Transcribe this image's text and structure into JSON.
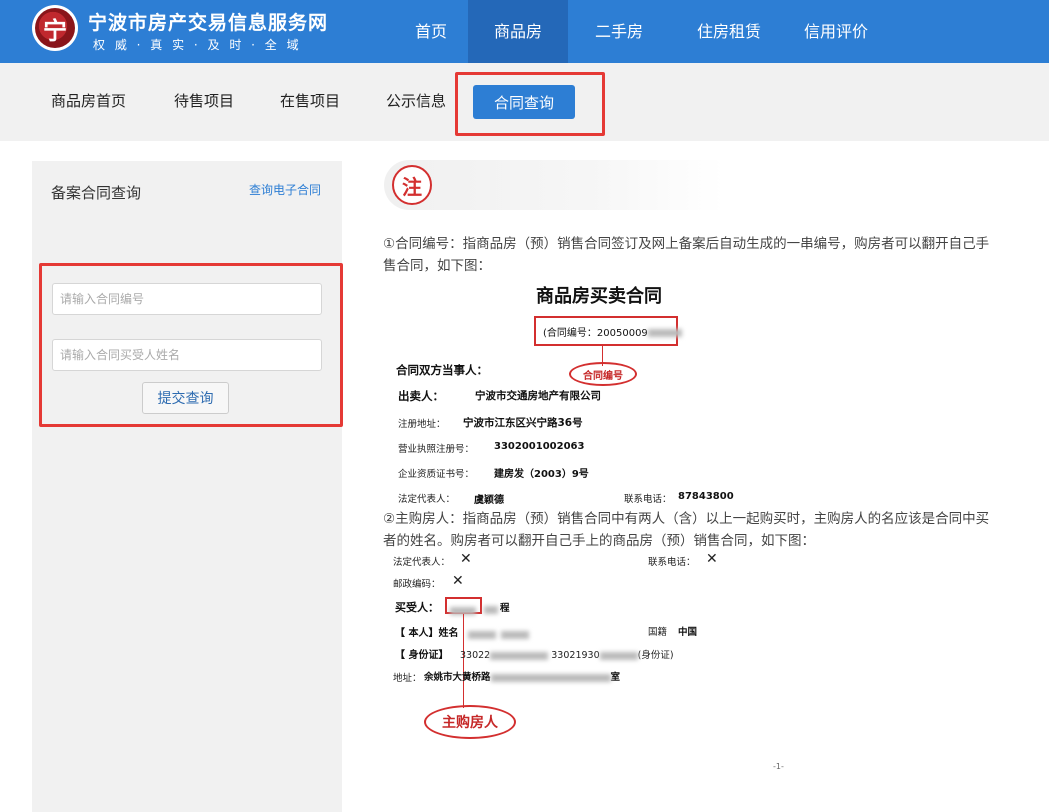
{
  "header": {
    "logo_char": "宁",
    "title": "宁波市房产交易信息服务网",
    "slogan": "权 威 · 真 实 · 及 时 · 全 域",
    "nav": [
      {
        "label": "首页"
      },
      {
        "label": "商品房",
        "active": true
      },
      {
        "label": "二手房"
      },
      {
        "label": "住房租赁"
      },
      {
        "label": "信用评价"
      }
    ]
  },
  "subnav": {
    "items": [
      "商品房首页",
      "待售项目",
      "在售项目",
      "公示信息"
    ],
    "active": "合同查询"
  },
  "sidebar": {
    "title": "备案合同查询",
    "link": "查询电子合同",
    "contract_number_placeholder": "请输入合同编号",
    "buyer_name_placeholder": "请输入合同买受人姓名",
    "submit_label": "提交查询"
  },
  "notes": {
    "badge": "注",
    "p1_line1": "①合同编号：指商品房（预）销售合同签订及网上备案后自动生成的一串编号，购房者可以翻开自己手",
    "p1_line2": "售合同，如下图：",
    "p2_line1": "②主购房人：指商品房（预）销售合同中有两人（含）以上一起购买时，主购房人的名应该是合同中买",
    "p2_line2": "者的姓名。购房者可以翻开自己手上的商品房（预）销售合同，如下图："
  },
  "contract_image_1": {
    "title": "商品房买卖合同",
    "contract_no": "(合同编号：20050009",
    "tag": "合同编号",
    "parties": "合同双方当事人：",
    "seller_label": "出卖人：",
    "seller_value": "宁波市交通房地产有限公司",
    "reg_addr_label": "注册地址：",
    "reg_addr_value": "宁波市江东区兴宁路36号",
    "license_label": "营业执照注册号：",
    "license_value": "3302001002063",
    "qual_label": "企业资质证书号：",
    "qual_value": "建房发（2003）9号",
    "rep_label": "法定代表人：",
    "rep_value": "虞颖德",
    "phone_label": "联系电话：",
    "phone_value": "87843800"
  },
  "contract_image_2": {
    "rep_label": "法定代表人：",
    "phone_label": "联系电话：",
    "postcode_label": "邮政编码：",
    "x_mark": "✕",
    "buyer_label": "买受人：",
    "buyer_suffix": "程",
    "self_label": "【 本人】姓名",
    "nationality_label": "国籍",
    "nationality_value": "中国",
    "id_label": "【 身份证】",
    "id_value_1": "33022",
    "id_value_2": "33021930",
    "id_suffix": "(身份证)",
    "addr_label": "地址：",
    "addr_value": "余姚市大黄桥路",
    "addr_suffix": "室",
    "tag": "主购房人",
    "page_mark": "-1-"
  }
}
